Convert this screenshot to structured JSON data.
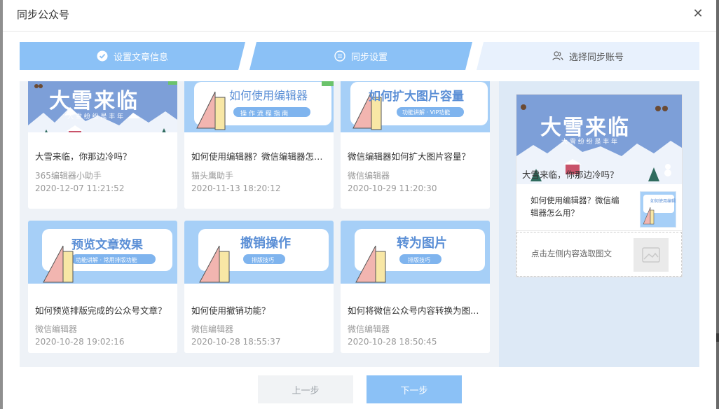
{
  "dialog": {
    "title": "同步公众号",
    "close_symbol": "✕"
  },
  "steps": [
    {
      "label": "设置文章信息",
      "icon": "check-circle-icon"
    },
    {
      "label": "同步设置",
      "icon": "list-circle-icon"
    },
    {
      "label": "选择同步账号",
      "icon": "users-icon"
    }
  ],
  "articles": [
    {
      "title": "大雪来临，你那边冷吗？",
      "author": "365编辑器小助手",
      "date": "2020-12-07 11:21:52",
      "thumb_title": "大雪来临",
      "thumb_subtitle": "大 雪 纷 纷 是 丰 年"
    },
    {
      "title": "如何使用编辑器？微信编辑器怎么用？",
      "author": "猫头鹰助手",
      "date": "2020-11-13 18:20:12",
      "thumb_title": "如何使用编辑器",
      "thumb_subtitle": "操 作 流 程 指 南"
    },
    {
      "title": "微信编辑器如何扩大图片容量？",
      "author": "微信编辑器",
      "date": "2020-10-29 11:20:30",
      "thumb_title": "如何扩大图片容量",
      "thumb_subtitle": "功能讲解 · VIP功能"
    },
    {
      "title": "如何预览排版完成的公众号文章？",
      "author": "微信编辑器",
      "date": "2020-10-28 19:02:16",
      "thumb_title": "预览文章效果",
      "thumb_subtitle": "功能讲解 · 常用排版功能"
    },
    {
      "title": "如何使用撤销功能？",
      "author": "微信编辑器",
      "date": "2020-10-28 18:55:37",
      "thumb_title": "撤销操作",
      "thumb_subtitle": "排版技巧"
    },
    {
      "title": "如何将微信公众号内容转换为图片？",
      "author": "微信编辑器",
      "date": "2020-10-28 18:50:45",
      "thumb_title": "转为图片",
      "thumb_subtitle": "排版技巧"
    }
  ],
  "preview": {
    "head_title": "大雪来临，你那边冷吗？",
    "head_thumb_title": "大雪来临",
    "head_thumb_subtitle": "大 雪 纷 纷 是 丰 年",
    "item_text": "如何使用编辑器？微信编辑器怎么用？",
    "item_thumb_title": "如何使用编辑",
    "empty_text": "点击左侧内容选取图文",
    "empty_icon": "image-placeholder-icon"
  },
  "buttons": {
    "prev": "上一步",
    "next": "下一步"
  },
  "colors": {
    "accent": "#8bc1f6",
    "step_inactive": "#e8f1fd",
    "content_bg": "#eef2f7",
    "preview_bg": "#dde9f6"
  }
}
